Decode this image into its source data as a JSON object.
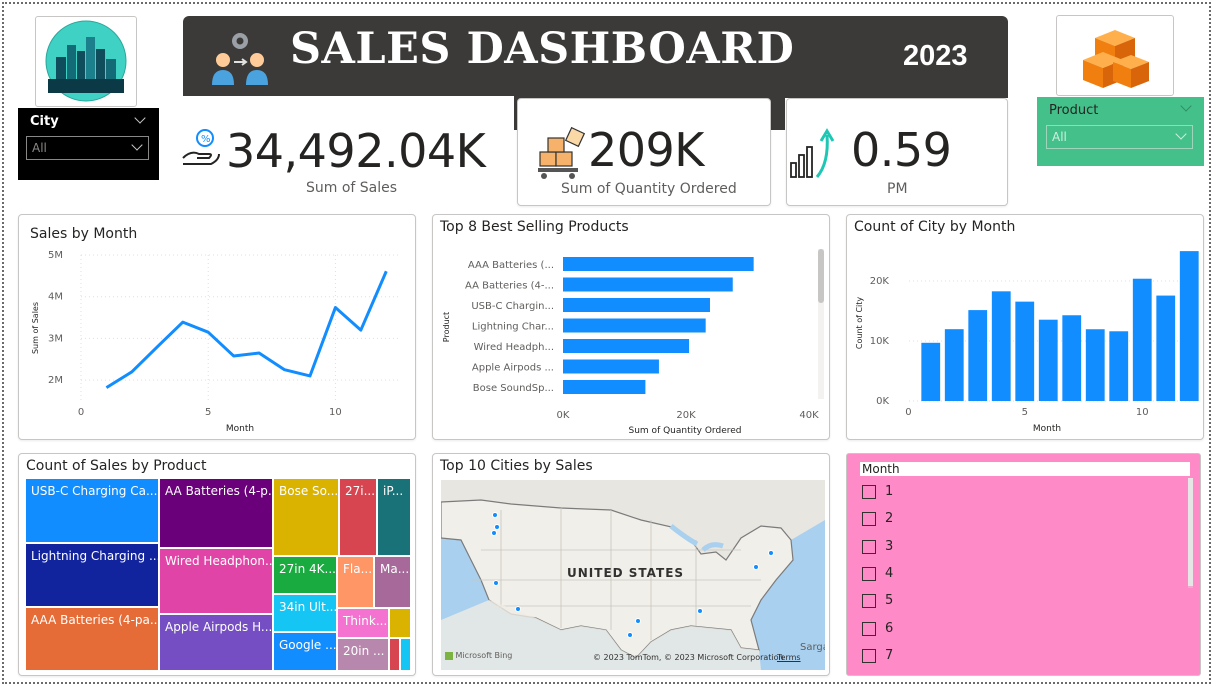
{
  "header": {
    "title": "SALES DASHBOARD",
    "year": "2023",
    "logo_icon": "city-skyline-icon",
    "team_icon": "team-gear-icon",
    "boxes_icon": "stacked-boxes-icon"
  },
  "slicers": {
    "city": {
      "label": "City",
      "value": "All"
    },
    "product": {
      "label": "Product",
      "value": "All"
    }
  },
  "kpis": {
    "sales": {
      "value": "34,492.04K",
      "label": "Sum of Sales",
      "icon": "money-hand-icon"
    },
    "quantity": {
      "value": "209K",
      "label": "Sum of Quantity Ordered",
      "icon": "boxes-dolly-icon"
    },
    "pm": {
      "value": "0.59",
      "label": "PM",
      "icon": "growth-chart-icon"
    }
  },
  "colors": {
    "accent": "#118dff",
    "banner": "#3b3a39",
    "product_slicer": "#44c18a",
    "month_panel": "#ff8ac8"
  },
  "chart_data": [
    {
      "type": "line",
      "title": "Sales by Month",
      "xlabel": "Month",
      "ylabel": "Sum of Sales",
      "x": [
        1,
        2,
        3,
        4,
        5,
        6,
        7,
        8,
        9,
        10,
        11,
        12
      ],
      "values": [
        1.82,
        2.2,
        2.8,
        3.39,
        3.15,
        2.58,
        2.65,
        2.25,
        2.1,
        3.74,
        3.2,
        4.61
      ],
      "xlim": [
        0,
        12.5
      ],
      "ylim": [
        1.5,
        5
      ],
      "xticks": [
        "0",
        "5",
        "10"
      ],
      "yticks": [
        "2M",
        "3M",
        "4M",
        "5M"
      ],
      "grid": true
    },
    {
      "type": "bar",
      "title": "Top 8 Best Selling Products",
      "xlabel": "Sum of Quantity Ordered",
      "ylabel": "Product",
      "categories": [
        "AAA Batteries (...",
        "AA Batteries (4-...",
        "USB-C Chargin...",
        "Lightning Char...",
        "Wired Headph...",
        "Apple Airpods ...",
        "Bose SoundSp..."
      ],
      "values": [
        31000,
        27600,
        23900,
        23200,
        20500,
        15600,
        13400
      ],
      "xlim": [
        0,
        40000
      ],
      "xticks": [
        "0K",
        "20K",
        "40K"
      ],
      "orientation": "horizontal"
    },
    {
      "type": "bar",
      "title": "Count of City by Month",
      "xlabel": "Month",
      "ylabel": "Count of City",
      "categories": [
        "1",
        "2",
        "3",
        "4",
        "5",
        "6",
        "7",
        "8",
        "9",
        "10",
        "11",
        "12"
      ],
      "values": [
        9700,
        11970,
        15150,
        18280,
        16560,
        13550,
        14290,
        11960,
        11620,
        20380,
        17570,
        24980
      ],
      "ylim": [
        0,
        26000
      ],
      "xticks": [
        "0",
        "5",
        "10"
      ],
      "yticks": [
        "0K",
        "10K",
        "20K"
      ],
      "grid": true
    },
    {
      "type": "treemap",
      "title": "Count of Sales by Product",
      "cells": [
        {
          "label": "USB-C Charging Ca...",
          "color": "#118dff"
        },
        {
          "label": "Lightning Charging ...",
          "color": "#12239e"
        },
        {
          "label": "AAA Batteries (4-pa...",
          "color": "#e66c37"
        },
        {
          "label": "AA Batteries (4-p...",
          "color": "#6b007b"
        },
        {
          "label": "Wired Headphon...",
          "color": "#e044a7"
        },
        {
          "label": "Apple Airpods H...",
          "color": "#744ec2"
        },
        {
          "label": "Bose So...",
          "color": "#d9b300"
        },
        {
          "label": "27i...",
          "color": "#d64550"
        },
        {
          "label": "iP...",
          "color": "#197278"
        },
        {
          "label": "27in 4K...",
          "color": "#1aab40"
        },
        {
          "label": "Fla...",
          "color": "#fe9666"
        },
        {
          "label": "Ma...",
          "color": "#a66999"
        },
        {
          "label": "34in Ult...",
          "color": "#15c6f4"
        },
        {
          "label": "Think...",
          "color": "#f472d0"
        },
        {
          "label": "Google ...",
          "color": "#118dff"
        },
        {
          "label": "20in ...",
          "color": "#b887ad"
        }
      ]
    }
  ],
  "map": {
    "title": "Top 10 Cities by Sales",
    "country_label": "UNITED STATES",
    "credit": "© 2023 TomTom, © 2023 Microsoft Corporation",
    "terms": "Terms",
    "bing": "Microsoft Bing",
    "corner": "Sarga"
  },
  "month_slicer": {
    "label": "Month",
    "items": [
      "1",
      "2",
      "3",
      "4",
      "5",
      "6",
      "7"
    ]
  }
}
